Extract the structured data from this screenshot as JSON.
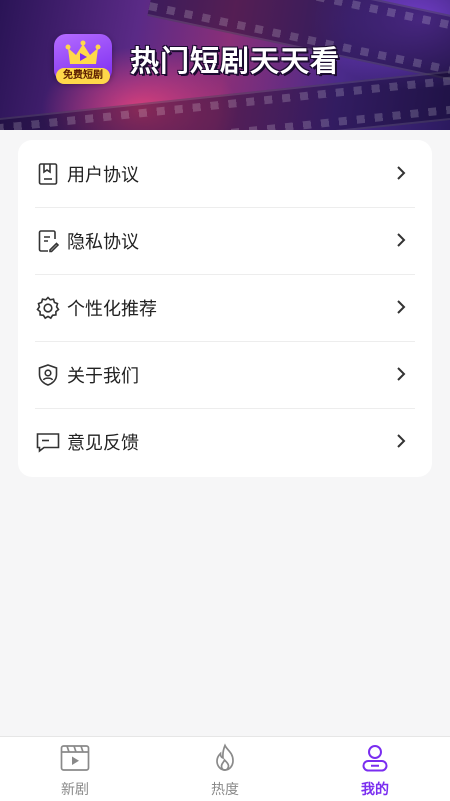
{
  "header": {
    "app_title": "热门短剧天天看",
    "logo_badge": "免费短剧"
  },
  "menu": {
    "items": [
      {
        "label": "用户协议",
        "icon": "document-icon"
      },
      {
        "label": "隐私协议",
        "icon": "edit-document-icon"
      },
      {
        "label": "个性化推荐",
        "icon": "gear-icon"
      },
      {
        "label": "关于我们",
        "icon": "shield-user-icon"
      },
      {
        "label": "意见反馈",
        "icon": "chat-bubble-icon"
      }
    ]
  },
  "tabs": [
    {
      "label": "新剧",
      "icon": "film-icon",
      "active": false
    },
    {
      "label": "热度",
      "icon": "flame-icon",
      "active": false
    },
    {
      "label": "我的",
      "icon": "user-icon",
      "active": true
    }
  ],
  "colors": {
    "accent": "#7a2df0",
    "background": "#f6f6f7",
    "card": "#ffffff"
  }
}
